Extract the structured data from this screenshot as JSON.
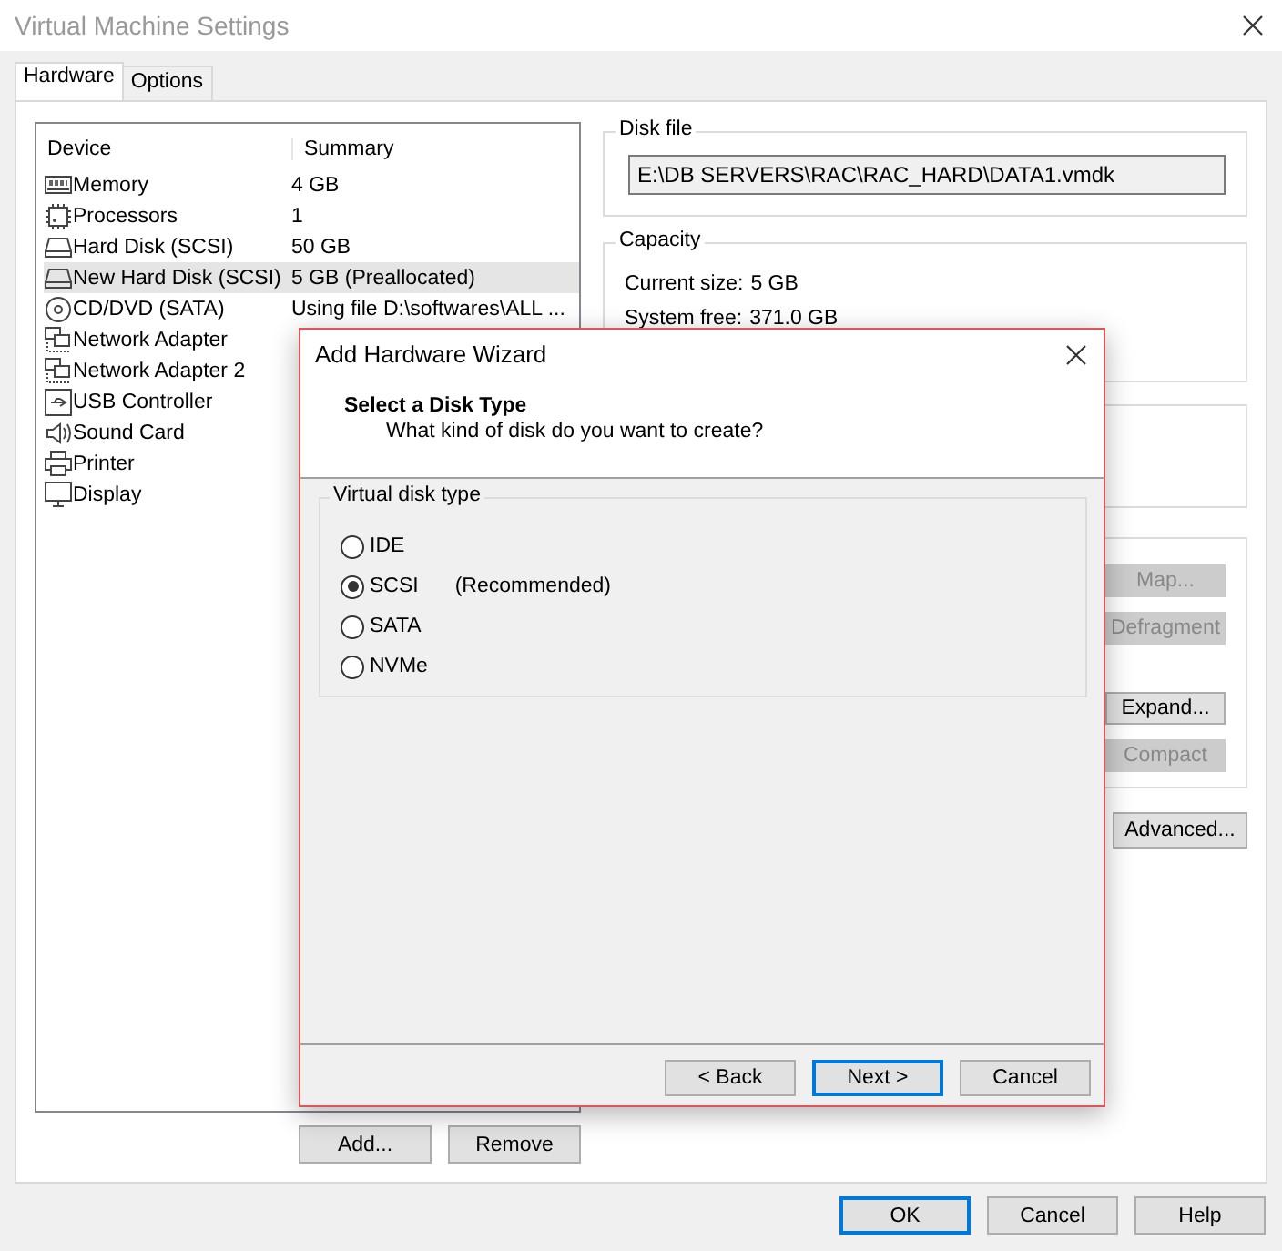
{
  "window": {
    "title": "Virtual Machine Settings"
  },
  "tabs": [
    {
      "label": "Hardware",
      "selected": true
    },
    {
      "label": "Options",
      "selected": false
    }
  ],
  "devices": {
    "columns": [
      "Device",
      "Summary"
    ],
    "rows": [
      {
        "kind": "memory",
        "name": "Memory",
        "summary": "4 GB",
        "selected": false
      },
      {
        "kind": "processor",
        "name": "Processors",
        "summary": "1",
        "selected": false
      },
      {
        "kind": "disk",
        "name": "Hard Disk (SCSI)",
        "summary": "50 GB",
        "selected": false
      },
      {
        "kind": "disk",
        "name": "New Hard Disk (SCSI)",
        "summary": "5 GB (Preallocated)",
        "selected": true
      },
      {
        "kind": "cd",
        "name": "CD/DVD (SATA)",
        "summary": "Using file D:\\softwares\\ALL ...",
        "selected": false
      },
      {
        "kind": "network",
        "name": "Network Adapter",
        "selected": false
      },
      {
        "kind": "network",
        "name": "Network Adapter 2",
        "selected": false
      },
      {
        "kind": "usb",
        "name": "USB Controller",
        "selected": false
      },
      {
        "kind": "sound",
        "name": "Sound Card",
        "selected": false
      },
      {
        "kind": "printer",
        "name": "Printer",
        "selected": false
      },
      {
        "kind": "display",
        "name": "Display",
        "selected": false
      }
    ]
  },
  "device_buttons": [
    "Add...",
    "Remove"
  ],
  "disk_file": {
    "label": "Disk file",
    "value": "E:\\DB SERVERS\\RAC\\RAC_HARD\\DATA1.vmdk"
  },
  "capacity": {
    "label": "Capacity",
    "current_size_label": "Current size:",
    "current_size": "5 GB",
    "system_free_label": "System free:",
    "system_free": "371.0 GB"
  },
  "disk_utilities": [
    {
      "label": "Map...",
      "disabled": true
    },
    {
      "label": "Defragment",
      "disabled": true
    },
    {
      "label": "Expand...",
      "disabled": false
    },
    {
      "label": "Compact",
      "disabled": true
    }
  ],
  "advanced_button": "Advanced...",
  "footer_buttons": [
    {
      "label": "OK",
      "default": true
    },
    {
      "label": "Cancel",
      "default": false
    },
    {
      "label": "Help",
      "default": false
    }
  ],
  "wizard": {
    "title": "Add Hardware Wizard",
    "heading": "Select a Disk Type",
    "subheading": "What kind of disk do you want to create?",
    "group_label": "Virtual disk type",
    "options": [
      {
        "label": "IDE",
        "selected": false
      },
      {
        "label": "SCSI",
        "note": "(Recommended)",
        "selected": true
      },
      {
        "label": "SATA",
        "selected": false
      },
      {
        "label": "NVMe",
        "selected": false
      }
    ],
    "buttons": [
      {
        "label": "< Back",
        "default": false
      },
      {
        "label": "Next >",
        "default": true
      },
      {
        "label": "Cancel",
        "default": false
      }
    ]
  }
}
